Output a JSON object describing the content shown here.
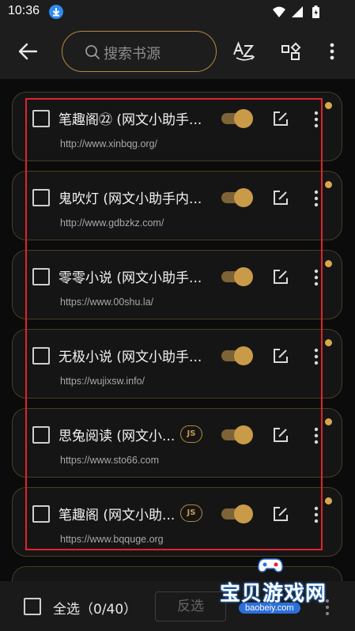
{
  "status_bar": {
    "time": "10:36"
  },
  "toolbar": {
    "search_placeholder": "搜索书源"
  },
  "sources": [
    {
      "title": "笔趣阁㉒ (网文小助手...",
      "url": "http://www.xinbqg.org/",
      "js": false,
      "enabled": true
    },
    {
      "title": "鬼吹灯 (网文小助手内...",
      "url": "http://www.gdbzkz.com/",
      "js": false,
      "enabled": true
    },
    {
      "title": "零零小说 (网文小助手...",
      "url": "https://www.00shu.la/",
      "js": false,
      "enabled": true
    },
    {
      "title": "无极小说 (网文小助手...",
      "url": "https://wujixsw.info/",
      "js": false,
      "enabled": true
    },
    {
      "title": "思兔阅读 (网文小...",
      "url": "https://www.sto66.com",
      "js": true,
      "enabled": true
    },
    {
      "title": "笔趣阁 (网文小助...",
      "url": "https://www.bqquge.org",
      "js": true,
      "enabled": true
    }
  ],
  "js_badge_label": "JS",
  "bottom_bar": {
    "select_all_label": "全选（0/40）",
    "invert_label": "反选"
  },
  "watermark": {
    "title": "宝贝游戏网",
    "subtitle": "baobeiy.com"
  },
  "colors": {
    "accent": "#c99a48",
    "highlight_box": "#e0242b",
    "background": "#0f0f0f"
  }
}
